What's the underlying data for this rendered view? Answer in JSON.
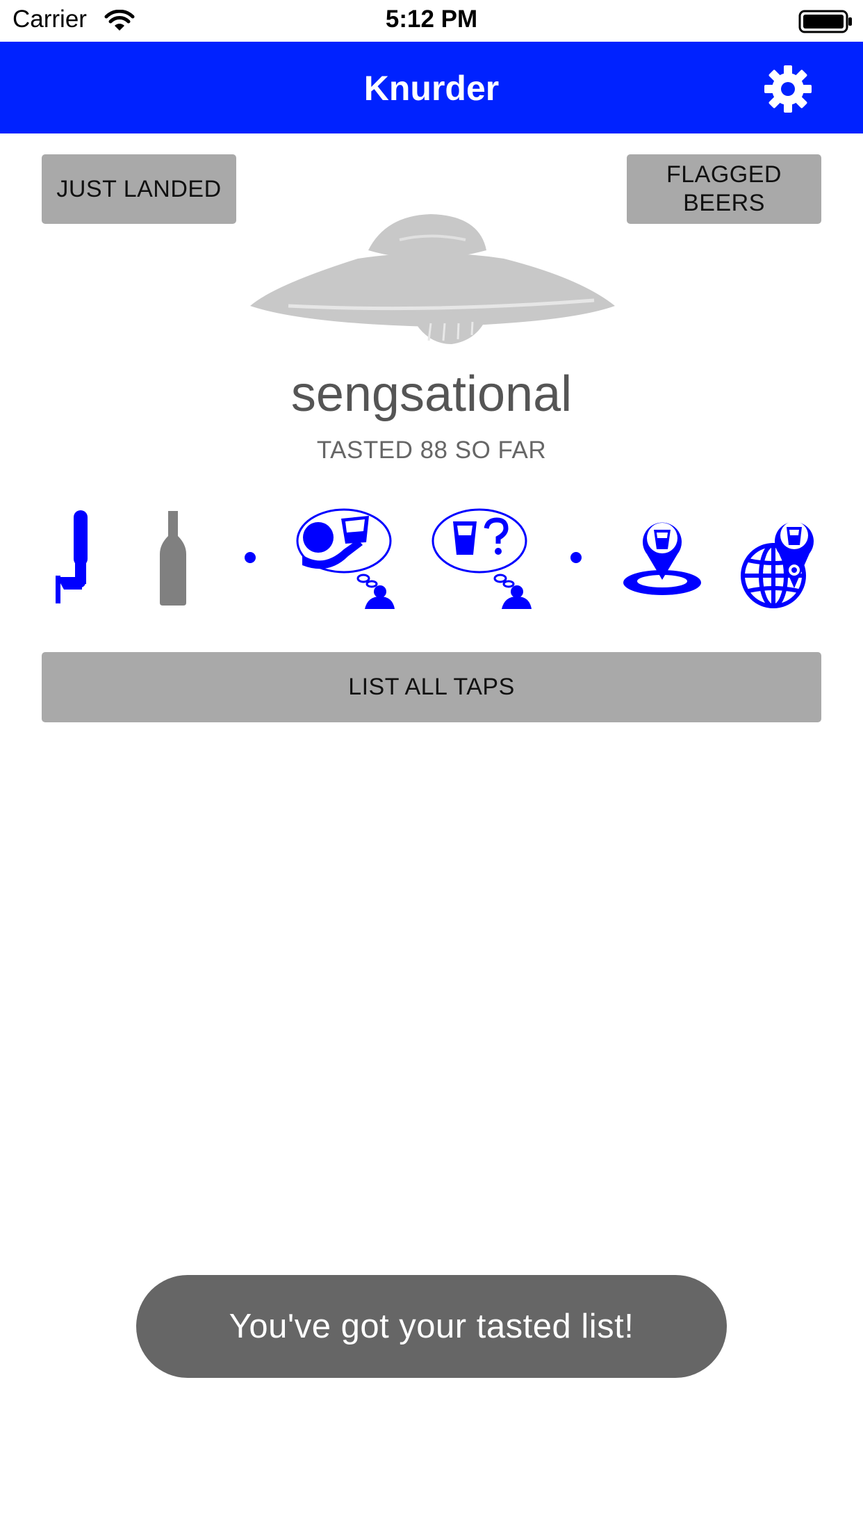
{
  "status_bar": {
    "carrier": "Carrier",
    "time": "5:12 PM"
  },
  "nav": {
    "title": "Knurder",
    "settings_icon": "gear-icon"
  },
  "buttons": {
    "just_landed": "JUST LANDED",
    "flagged_beers_line1": "FLAGGED",
    "flagged_beers_line2": "BEERS",
    "list_all_taps": "LIST ALL TAPS"
  },
  "user": {
    "name": "sengsational",
    "tasted_summary": "TASTED 88 SO FAR"
  },
  "filter_icons": [
    "beer-tap-icon",
    "bottle-icon",
    "separator-dot-icon",
    "tasted-thought-icon",
    "untasted-thought-icon",
    "separator-dot-icon",
    "local-location-icon",
    "global-location-icon"
  ],
  "toast": {
    "message": "You've got your tasted list!"
  },
  "colors": {
    "accent": "#0000ff",
    "nav_bar": "#0022ff",
    "button_gray": "#a9a9a9",
    "toast_bg": "#666666",
    "bottle_gray": "#808080",
    "ufo_gray": "#c8c8c8"
  }
}
